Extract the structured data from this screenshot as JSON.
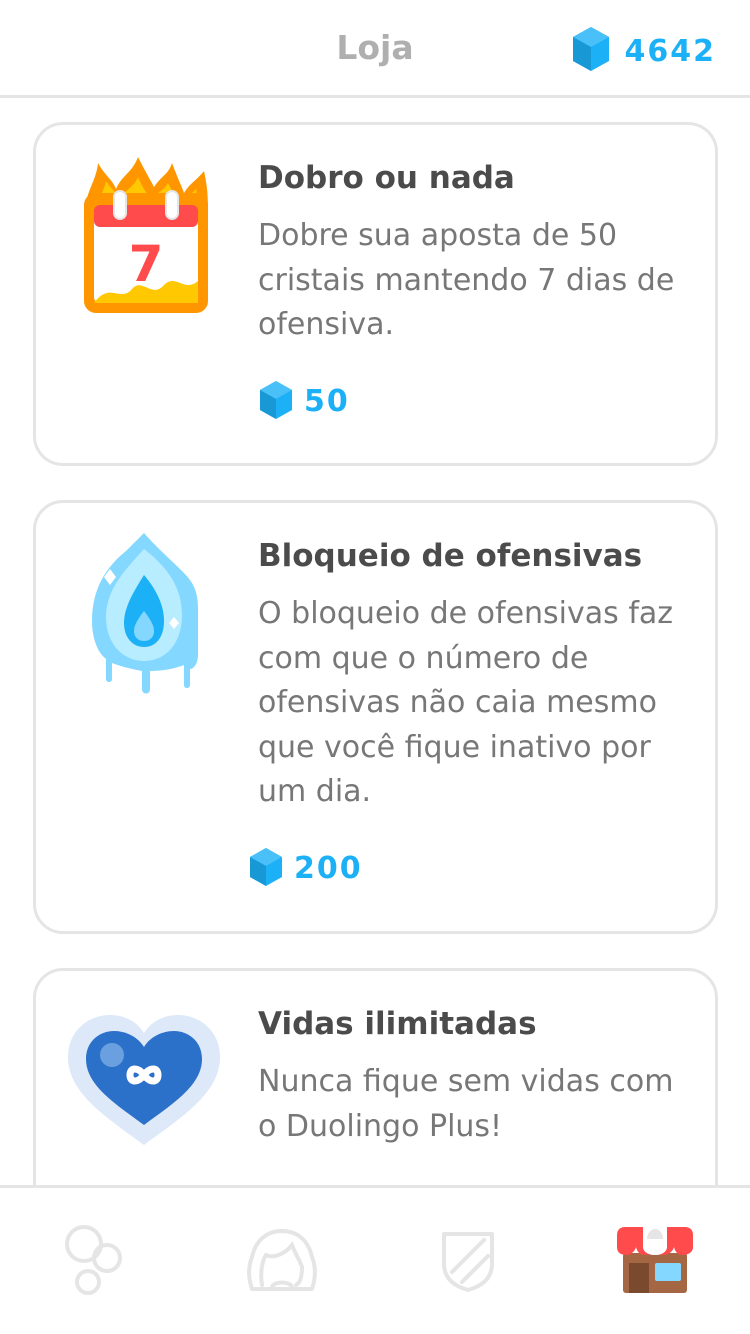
{
  "header": {
    "title": "Loja",
    "gem_count": "4642",
    "gem_icon": "gem-icon"
  },
  "items": [
    {
      "name": "Dobro ou nada",
      "description": "Dobre sua aposta de 50 cristais mantendo 7 dias de ofensiva.",
      "price": "50",
      "icon": "flaming-calendar-icon",
      "calendar_day": "7"
    },
    {
      "name": "Bloqueio de ofensivas",
      "description": "O bloqueio de ofensivas faz com que o número de ofensivas não caia mesmo que você fique inativo por um dia.",
      "price": "200",
      "icon": "frozen-flame-icon"
    },
    {
      "name": "Vidas ilimitadas",
      "description": "Nunca fique sem vidas com o Duolingo Plus!",
      "icon": "infinity-heart-icon"
    }
  ],
  "tabs": [
    {
      "icon": "learn-bubbles-icon",
      "active": false
    },
    {
      "icon": "profile-icon",
      "active": false
    },
    {
      "icon": "leaderboard-shield-icon",
      "active": false
    },
    {
      "icon": "shop-icon",
      "active": true
    }
  ],
  "colors": {
    "accent_blue": "#1cb0f6",
    "text_dark": "#4b4b4b",
    "text_gray": "#777777",
    "border": "#e5e5e5"
  }
}
